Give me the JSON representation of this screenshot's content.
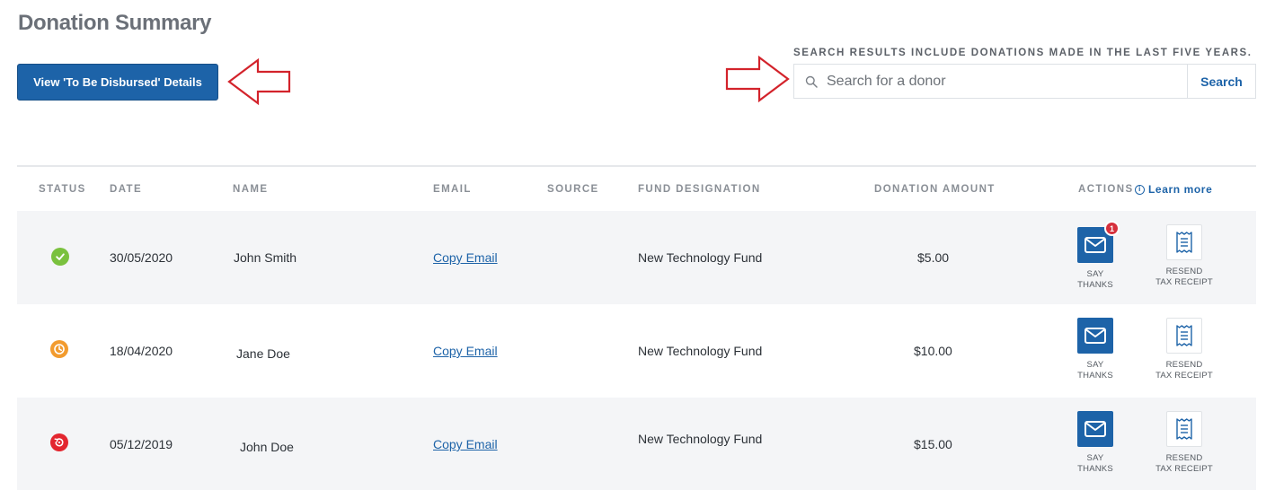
{
  "page": {
    "title": "Donation Summary"
  },
  "toolbar": {
    "disbursed_button": "View 'To Be Disbursed' Details"
  },
  "search": {
    "note": "SEARCH RESULTS INCLUDE DONATIONS MADE IN THE LAST FIVE YEARS.",
    "placeholder": "Search for a donor",
    "button": "Search"
  },
  "table": {
    "headers": {
      "status": "STATUS",
      "date": "DATE",
      "name": "NAME",
      "email": "EMAIL",
      "source": "SOURCE",
      "fund": "FUND DESIGNATION",
      "amount": "DONATION AMOUNT",
      "actions": "ACTIONS",
      "learn_more": "Learn more"
    },
    "rows": [
      {
        "status": "completed",
        "date": "30/05/2020",
        "name": "John Smith",
        "email_link": "Copy Email",
        "source": "",
        "fund": "New Technology Fund",
        "amount": "$5.00",
        "say_thanks": [
          "SAY",
          "THANKS"
        ],
        "resend": [
          "RESEND",
          "TAX RECEIPT"
        ],
        "badge": "1"
      },
      {
        "status": "pending",
        "date": "18/04/2020",
        "name": "Jane Doe",
        "email_link": "Copy Email",
        "source": "",
        "fund": "New Technology Fund",
        "amount": "$10.00",
        "say_thanks": [
          "SAY",
          "THANKS"
        ],
        "resend": [
          "RESEND",
          "TAX RECEIPT"
        ]
      },
      {
        "status": "refunded",
        "date": "05/12/2019",
        "name": "John Doe",
        "email_link": "Copy Email",
        "source": "",
        "fund": "New Technology Fund",
        "amount": "$15.00",
        "say_thanks": [
          "SAY",
          "THANKS"
        ],
        "resend": [
          "RESEND",
          "TAX RECEIPT"
        ]
      }
    ]
  },
  "colors": {
    "primary": "#1d63a8",
    "status_completed": "#7ac13e",
    "status_pending": "#f29b2e",
    "status_refunded": "#e3262f",
    "annotation_arrow": "#d3232b",
    "notification_badge": "#d6303c"
  },
  "icons": {
    "search": "search-icon",
    "info": "info-icon",
    "say_thanks": "envelope-icon",
    "resend": "receipt-icon",
    "completed": "checkmark-icon",
    "pending": "clock-icon",
    "refunded": "refund-icon",
    "annotations": "arrow-outline-icon"
  }
}
